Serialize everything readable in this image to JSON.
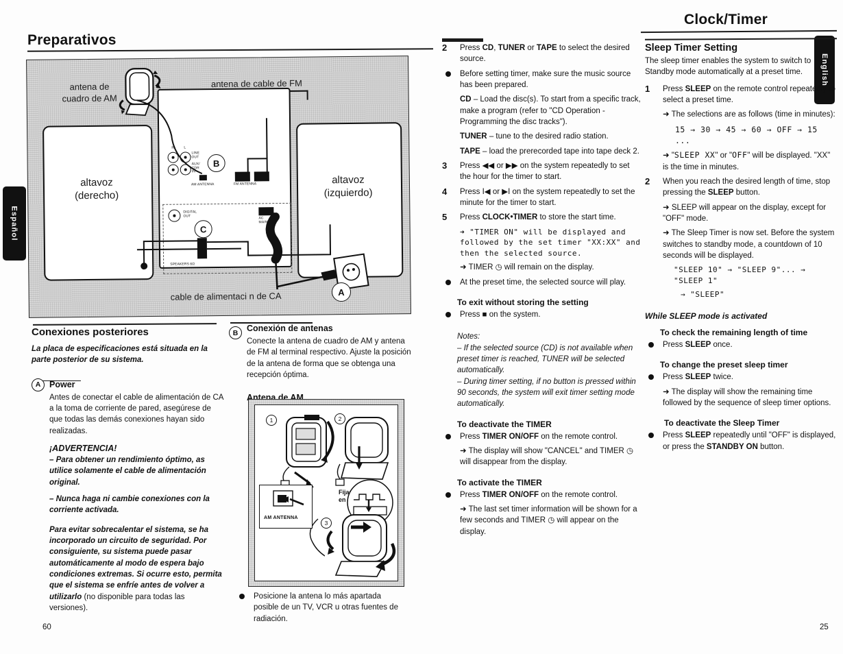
{
  "page": {
    "left_page_number": "60",
    "right_page_number": "25",
    "left_tab": "Español",
    "right_tab": "English"
  },
  "headings": {
    "left": "Preparativos",
    "right": "Clock/Timer"
  },
  "diagram": {
    "label_am_antenna": "antena de\ncuadro de AM",
    "label_fm_antenna": "antena de cable de FM",
    "label_speaker_right": "altavoz\n(derecho)",
    "label_speaker_left": "altavoz\n(izquierdo)",
    "label_ac_cord": "cable de alimentaci n de CA",
    "marker_a": "A",
    "marker_b": "B",
    "marker_c": "C",
    "jack_r": "R",
    "jack_l": "L",
    "jack_line_out": "LINE\nOUT",
    "jack_aux_cdr_in": "AUX/\nCDR\nIN",
    "jack_am_antenna": "AM ANTENNA",
    "jack_fm_antenna": "FM ANTENNA",
    "jack_digital_out": "DIGITAL\nOUT",
    "jack_ac_mains": "AC\nMAINS",
    "jack_speakers": "SPEAKERS 6Ω"
  },
  "spanish": {
    "connections_heading": "Conexiones posteriores",
    "connections_note": "La placa de especificaciones está situada en la parte posterior de su sistema.",
    "power_marker": "A",
    "power_heading": "Power",
    "power_body": "Antes de conectar el cable de alimentación de CA a la toma de corriente de pared, asegúrese de que todas las demás conexiones hayan sido realizadas.",
    "warning_heading": "¡ADVERTENCIA!",
    "warning_1": "– Para obtener un rendimiento óptimo, as utilice solamente el cable de alimentación original.",
    "warning_2": "– Nunca haga ni cambie conexiones con la corriente activada.",
    "overheat_bold": "Para evitar sobrecalentar el sistema, se ha incorporado un circuito de seguridad. Por consiguiente, su sistema puede pasar automáticamente al modo de espera bajo condiciones extremas. Si ocurre esto, permita que el sistema se enfríe antes de volver a utilizarlo",
    "overheat_light": " (no disponible para todas las versiones).",
    "antenna_marker": "B",
    "antenna_heading": "Conexión de antenas",
    "antenna_body": "Conecte la antena de cuadro de AM y antena de FM al terminal respectivo. Ajuste la posición de la antena de forma que se obtenga una recepción óptima.",
    "am_antenna_heading": "Antena de AM",
    "am_fig_step1": "1",
    "am_fig_step2": "2",
    "am_fig_step3": "3",
    "am_fig_hook": "Fijar el gancho\nen la apertura",
    "am_fig_jack": "AM ANTENNA",
    "am_bullet": "Posicione la antena lo más apartada posible de un TV, VCR u otras fuentes de radiación."
  },
  "english_timer": {
    "step2_num": "2",
    "step2_text_pre": "Press ",
    "step2_cd": "CD",
    "step2_sep1": ", ",
    "step2_tuner": "TUNER",
    "step2_sep2": " or ",
    "step2_tape": "TAPE",
    "step2_text_post": " to select the desired source.",
    "bullet1": "Before setting timer, make sure the music source has been prepared.",
    "cd_label": "CD",
    "cd_text": " – Load the disc(s). To start from a specific track, make a program (refer to \"CD Operation - Programming the disc tracks\").",
    "tuner_label": "TUNER",
    "tuner_text": " – tune to the desired radio station.",
    "tape_label": "TAPE",
    "tape_text": " – load the prerecorded tape into tape deck 2.",
    "step3_num": "3",
    "step3_text": "Press ◀◀ or ▶▶  on the system repeatedly to set the hour for the timer to start.",
    "step4_num": "4",
    "step4_text": "Press I◀ or ▶I on the system repeatedly to set the minute for the timer to start.",
    "step5_num": "5",
    "step5_pre": "Press ",
    "step5_btn": "CLOCK•TIMER",
    "step5_post": " to store the start time.",
    "step5_arrow1": "➜ \"TIMER ON\" will be displayed and followed by the set timer \"XX:XX\" and then the selected source.",
    "step5_arrow2": "➜ TIMER ◷ will remain on the display.",
    "bullet2": "At the preset time, the selected source will play.",
    "exit_heading": "To exit without storing the setting",
    "exit_bullet": "Press ■ on the system.",
    "notes_label": "Notes:",
    "note1": "– If the selected source (CD) is not available when preset timer is reached, TUNER will be selected automatically.",
    "note2": "– During timer setting, if no button is pressed within 90 seconds, the system will exit timer setting mode automatically.",
    "deactivate_heading": "To deactivate the TIMER",
    "deactivate_pre": "Press ",
    "deactivate_btn": "TIMER ON/OFF",
    "deactivate_post": " on the remote control.",
    "deactivate_arrow": "➜ The display will show \"CANCEL\" and TIMER ◷ will disappear from the display.",
    "activate_heading": "To activate the TIMER",
    "activate_pre": "Press ",
    "activate_btn": "TIMER ON/OFF",
    "activate_post": " on the remote control.",
    "activate_arrow": "➜ The last set timer information will be shown for a few seconds and TIMER ◷ will appear on the display."
  },
  "english_sleep": {
    "heading": "Sleep Timer Setting",
    "intro": "The sleep timer enables the system to switch to Standby mode automatically at a preset time.",
    "step1_num": "1",
    "step1_pre": "Press ",
    "step1_btn": "SLEEP",
    "step1_post": " on the remote control repeatedly to select a preset time.",
    "step1_arrow1": "➜ The selections are as follows (time in minutes):",
    "sequence": "15 → 30 → 45 → 60 → OFF →  15 ...",
    "step1_arrow2_pre": "➜ \"",
    "step1_arrow2_lcd1": "SLEEP XX",
    "step1_arrow2_mid": "\" or \"",
    "step1_arrow2_lcd2": "OFF",
    "step1_arrow2_post": "\" will be displayed. \"XX\" is the time in minutes.",
    "step2_num": "2",
    "step2_pre": "When you reach the desired length of time, stop pressing the ",
    "step2_btn": "SLEEP",
    "step2_post": " button.",
    "step2_arrow1": "➜ SLEEP will appear on the display, except for \"OFF\" mode.",
    "step2_arrow2": "➜ The Sleep Timer is now set. Before the system switches to standby mode, a countdown of 10 seconds will be displayed.",
    "countdown1": "\"SLEEP 10\" → \"SLEEP 9\"... → \"SLEEP 1\"",
    "countdown2": "→ \"SLEEP\"",
    "while_heading": "While SLEEP mode is activated",
    "check_heading": "To check the remaining length of time",
    "check_pre": "Press ",
    "check_btn": "SLEEP",
    "check_post": " once.",
    "change_heading": "To change the preset sleep timer",
    "change_pre": "Press ",
    "change_btn": "SLEEP",
    "change_post": " twice.",
    "change_arrow": "➜ The display will show the remaining time followed by the sequence of sleep timer options.",
    "deact_heading": "To deactivate the Sleep Timer",
    "deact_pre": "Press ",
    "deact_btn": "SLEEP",
    "deact_mid": " repeatedly until \"OFF\" is displayed, or press the ",
    "deact_btn2": "STANDBY ON",
    "deact_post": " button."
  }
}
